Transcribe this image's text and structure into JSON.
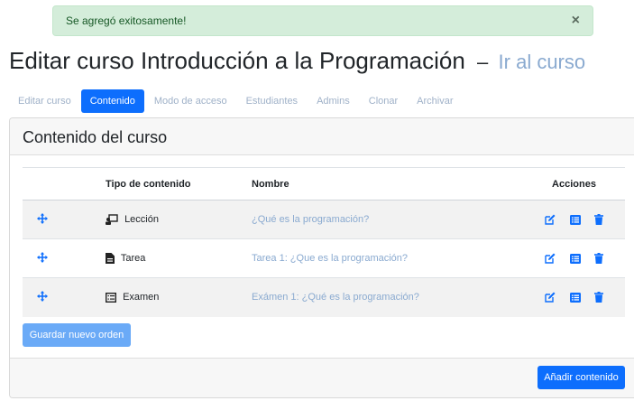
{
  "alert": {
    "message": "Se agregó exitosamente!",
    "close": "×"
  },
  "header": {
    "title": "Editar curso Introducción a la Programación",
    "separator": "–",
    "link": "Ir al curso"
  },
  "tabs": [
    {
      "label": "Editar curso",
      "active": false
    },
    {
      "label": "Contenido",
      "active": true
    },
    {
      "label": "Modo de acceso",
      "active": false
    },
    {
      "label": "Estudiantes",
      "active": false
    },
    {
      "label": "Admins",
      "active": false
    },
    {
      "label": "Clonar",
      "active": false
    },
    {
      "label": "Archivar",
      "active": false
    }
  ],
  "card": {
    "title": "Contenido del curso",
    "columns": {
      "tipo": "Tipo de contenido",
      "nombre": "Nombre",
      "acciones": "Acciones"
    },
    "rows": [
      {
        "tipo": "Lección",
        "icon": "lesson-icon",
        "nombre": "¿Qué es la programación?"
      },
      {
        "tipo": "Tarea",
        "icon": "file-icon",
        "nombre": "Tarea 1: ¿Que es la programación?"
      },
      {
        "tipo": "Examen",
        "icon": "list-icon",
        "nombre": "Exámen 1: ¿Qué es la programación?"
      }
    ],
    "save_order": "Guardar nuevo orden",
    "add_content": "Añadir contenido"
  },
  "colors": {
    "primary": "#0d6efd",
    "alert_bg": "#d4edda",
    "alert_text": "#155724",
    "link": "#8aaad0"
  }
}
